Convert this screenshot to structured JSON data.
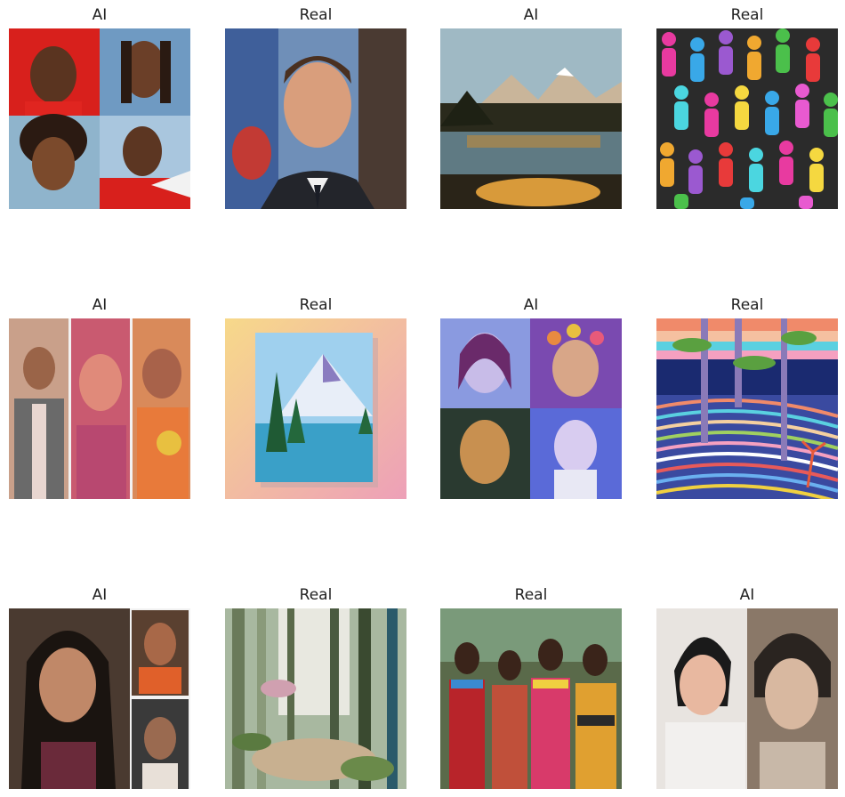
{
  "images": [
    {
      "label": "AI"
    },
    {
      "label": "Real"
    },
    {
      "label": "AI"
    },
    {
      "label": "Real"
    },
    {
      "label": "AI"
    },
    {
      "label": "Real"
    },
    {
      "label": "AI"
    },
    {
      "label": "Real"
    },
    {
      "label": "AI"
    },
    {
      "label": "Real"
    },
    {
      "label": "Real"
    },
    {
      "label": "AI"
    }
  ]
}
